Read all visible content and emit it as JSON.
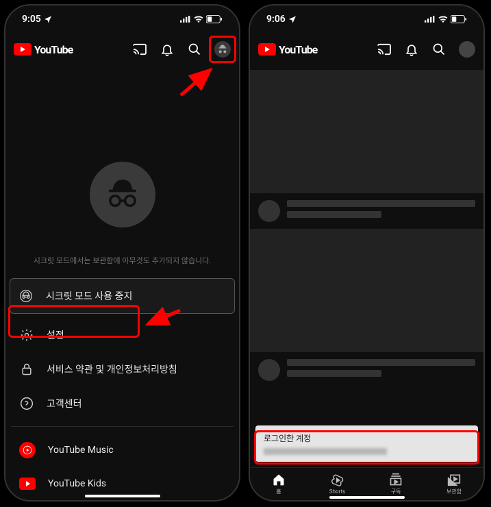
{
  "left": {
    "status": {
      "time": "9:05",
      "location_arrow": "➤"
    },
    "brand": "YouTube",
    "incognito_message": "시크릿 모드에서는 보관함에 아무것도 추가되지 않습니다.",
    "menu": {
      "stop_incognito": "시크릿 모드 사용 중지",
      "settings": "설정",
      "terms": "서비스 약관 및 개인정보처리방침",
      "help": "고객센터",
      "ytmusic": "YouTube Music",
      "ytkids": "YouTube Kids"
    }
  },
  "right": {
    "status": {
      "time": "9:06"
    },
    "brand": "YouTube",
    "toast": {
      "title": "로그인한 계정"
    },
    "nav": {
      "home": "홈",
      "shorts": "Shorts",
      "subs": "구독",
      "library": "보관함"
    }
  }
}
